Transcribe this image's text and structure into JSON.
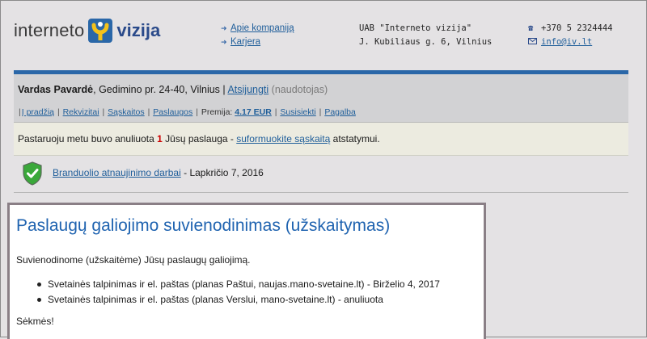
{
  "header": {
    "logo_left": "interneto",
    "logo_right": "vizija",
    "links": [
      {
        "label": "Apie kompaniją"
      },
      {
        "label": "Karjera"
      }
    ],
    "company_name": "UAB \"Interneto vizija\"",
    "company_address": "J. Kubiliaus g. 6, Vilnius",
    "phone": "+370 5 2324444",
    "email": "info@iv.lt"
  },
  "user": {
    "name": "Vardas Pavardė",
    "address": ", Gedimino pr. 24-40, Vilnius |",
    "logout_label": "Atsijungti",
    "role": "(naudotojas)"
  },
  "menu": {
    "items": [
      "Į pradžią",
      "Rekvizitai",
      "Sąskaitos",
      "Paslaugos"
    ],
    "premium_label": "Premija:",
    "premium_value": "4.17 EUR",
    "extra_items": [
      "Susisiekti",
      "Pagalba"
    ]
  },
  "notice": {
    "before": "Pastaruoju metu buvo anuliuota",
    "count": "1",
    "middle": "Jūsų paslauga -",
    "link": "suformuokite sąskaitą",
    "after": "atstatymui."
  },
  "maintenance": {
    "link": "Branduolio atnaujinimo darbai",
    "date": "- Lapkričio 7, 2016"
  },
  "message": {
    "title": "Paslaugų galiojimo suvienodinimas (užskaitymas)",
    "intro": "Suvienodinome (užskaitėme) Jūsų paslaugų galiojimą.",
    "items": [
      "Svetainės talpinimas ir el. paštas (planas Paštui, naujas.mano-svetaine.lt) - Birželio 4, 2017",
      "Svetainės talpinimas ir el. paštas (planas Verslui, mano-svetaine.lt) - anuliuota"
    ],
    "closing": "Sėkmės!"
  },
  "colors": {
    "accent_blue": "#2a67a8",
    "link": "#1f5e9a",
    "title_blue": "#1f63b0",
    "alert_red": "#cc0000",
    "shield_green": "#3aa83a"
  }
}
